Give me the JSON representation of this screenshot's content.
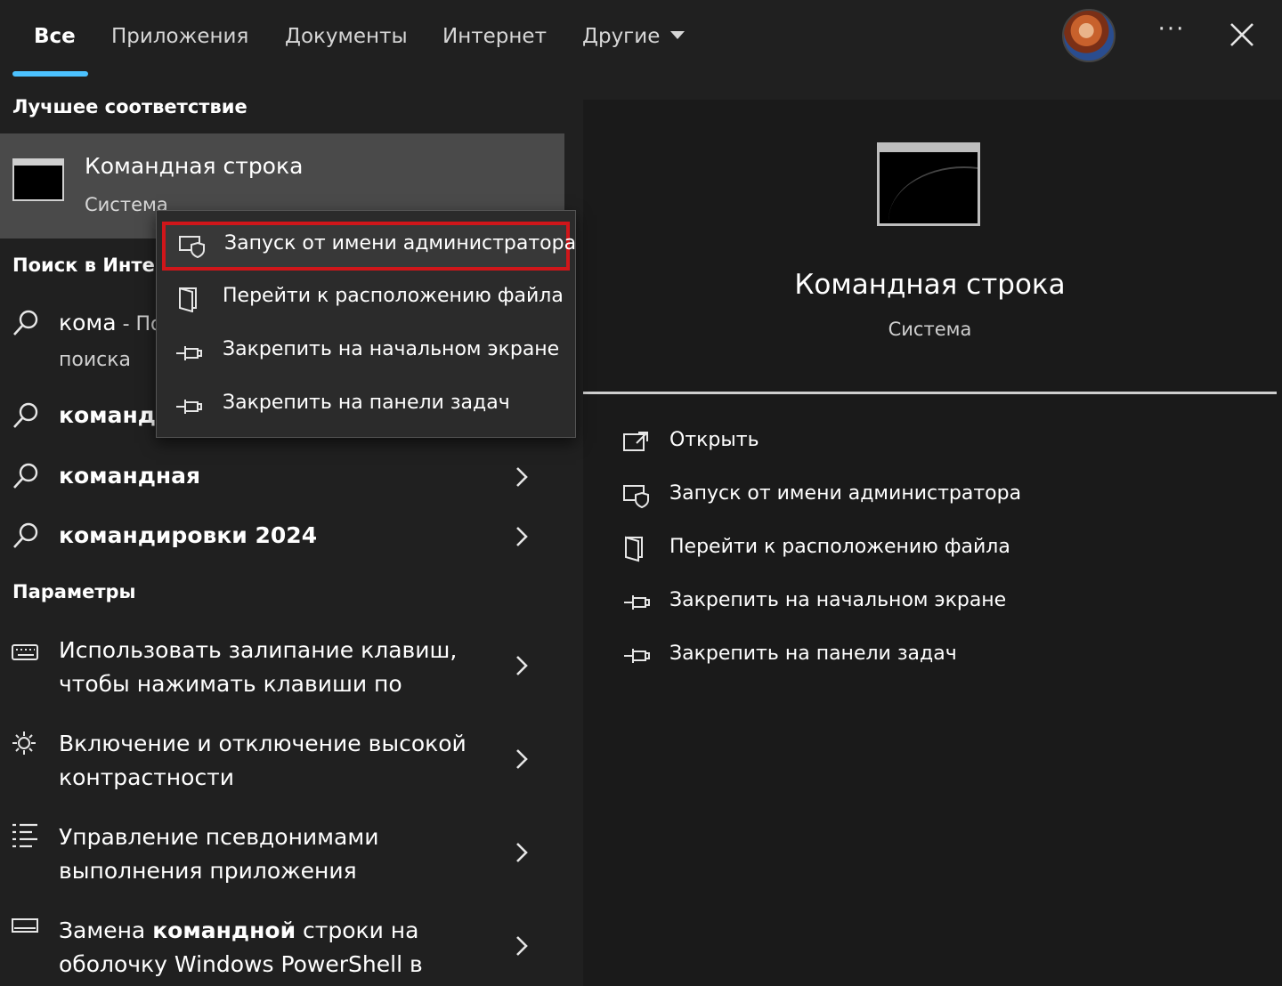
{
  "tabs": [
    {
      "label": "Все",
      "active": true
    },
    {
      "label": "Приложения"
    },
    {
      "label": "Документы"
    },
    {
      "label": "Интернет"
    },
    {
      "label": "Другие"
    }
  ],
  "header": {
    "more_label": "···"
  },
  "best_match": {
    "section_title": "Лучшее соответствие",
    "title": "Командная строка",
    "subtitle": "Система"
  },
  "web_search": {
    "section_title": "Поиск в Интер",
    "items": [
      {
        "text": "кома",
        "suffix": " - По",
        "sub": "поиска"
      },
      {
        "text": "командн"
      },
      {
        "text": "командная"
      },
      {
        "text": "командировки 2024"
      }
    ]
  },
  "settings": {
    "section_title": "Параметры",
    "items": [
      {
        "line1": "Использовать залипание клавиш,",
        "line2": "чтобы нажимать клавиши по",
        "icon": "keyboard-icon"
      },
      {
        "line1": "Включение и отключение высокой",
        "line2": "контрастности",
        "icon": "brightness-icon"
      },
      {
        "line1": "Управление псевдонимами",
        "line2": "выполнения приложения",
        "icon": "list-icon"
      },
      {
        "line1_pre": "Замена ",
        "line1_bold": "командной",
        "line1_post": " строки на",
        "line2": "оболочку Windows PowerShell в",
        "icon": "display-icon"
      }
    ]
  },
  "context_menu": {
    "items": [
      {
        "label": "Запуск от имени администратора",
        "icon": "admin-shield-icon",
        "highlighted": true
      },
      {
        "label": "Перейти к расположению файла",
        "icon": "file-location-icon"
      },
      {
        "label": "Закрепить на начальном экране",
        "icon": "pin-icon"
      },
      {
        "label": "Закрепить на панели задач",
        "icon": "pin-icon"
      }
    ]
  },
  "preview": {
    "title": "Командная строка",
    "subtitle": "Система",
    "actions": [
      {
        "label": "Открыть",
        "icon": "open-icon"
      },
      {
        "label": "Запуск от имени администратора",
        "icon": "admin-shield-icon"
      },
      {
        "label": "Перейти к расположению файла",
        "icon": "file-location-icon"
      },
      {
        "label": "Закрепить на начальном экране",
        "icon": "pin-icon"
      },
      {
        "label": "Закрепить на панели задач",
        "icon": "pin-icon"
      }
    ]
  },
  "colors": {
    "accent": "#4cc2ff",
    "highlight_border": "#d0161a",
    "selected_bg": "#4a4a4a"
  }
}
